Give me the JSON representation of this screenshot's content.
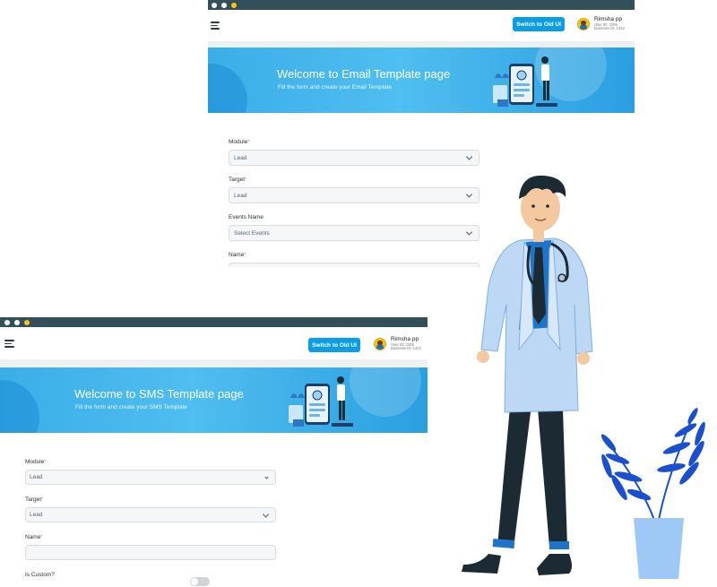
{
  "colors": {
    "titlebar": "#33505a",
    "accent": "#0c9de8",
    "banner": "#3aaee8",
    "required": "#e53935"
  },
  "email_window": {
    "switch_button": "Switch to Old UI",
    "user": {
      "name": "Rimsha pp",
      "user_id": "User ID: 2209",
      "business_id": "Business ID: 1422"
    },
    "banner": {
      "title": "Welcome to Email Template page",
      "subtitle": "Fill the form and create your Email Template"
    },
    "form": {
      "module_label": "Module",
      "module_value": "Lead",
      "target_label": "Target",
      "target_value": "Lead",
      "events_label": "Events Name",
      "events_placeholder": "Select Events",
      "name_label": "Name"
    }
  },
  "sms_window": {
    "switch_button": "Switch to Old UI",
    "user": {
      "name": "Rimsha pp",
      "user_id": "User ID: 2209",
      "business_id": "Business ID: 1422"
    },
    "banner": {
      "title": "Welcome to SMS Template page",
      "subtitle": "Fill the form and create your SMS Template"
    },
    "form": {
      "module_label": "Module",
      "module_value": "Lead",
      "target_label": "Target",
      "target_value": "Lead",
      "name_label": "Name",
      "name_value": "",
      "is_custom_label": "Is Custom?",
      "is_custom_on": false
    }
  },
  "icons": [
    "menu-icon",
    "chevron-down-icon",
    "avatar",
    "doctor-illustration",
    "plant-illustration"
  ]
}
